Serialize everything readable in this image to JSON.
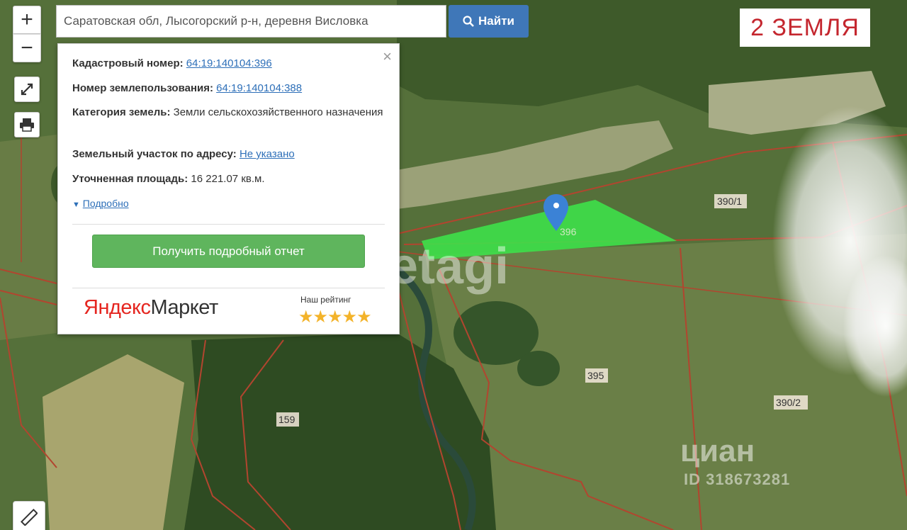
{
  "search": {
    "value": "Саратовская обл, Лысогорский р-н, деревня Висловка",
    "button_label": "Найти"
  },
  "controls": {
    "zoom_in": "+",
    "zoom_out": "−"
  },
  "overlay_label": "2 ЗЕМЛЯ",
  "popup": {
    "cadastral_label": "Кадастровый номер:",
    "cadastral_value": "64:19:140104:396",
    "land_use_label": "Номер землепользования:",
    "land_use_value": "64:19:140104:388",
    "category_label": "Категория земель:",
    "category_value": "Земли сельскохозяйственного назначения",
    "address_label": "Земельный участок по адресу:",
    "address_value": "Не указано",
    "area_label": "Уточненная площадь:",
    "area_value": "16 221.07 кв.м.",
    "more_link": "Подробно",
    "report_button": "Получить подробный отчет",
    "logo_part1": "Яндекс",
    "logo_part2": "Маркет",
    "rating_label": "Наш рейтинг",
    "stars": "★★★★★"
  },
  "parcel_labels": {
    "p396": "396",
    "p390_1": "390/1",
    "p395": "395",
    "p390_2": "390/2",
    "p159": "159"
  },
  "watermarks": {
    "etagi": "etagi",
    "cian": "циан",
    "cian_id": "ID 318673281"
  },
  "colors": {
    "parcel_fill": "#3ee04a",
    "boundary": "#b2452f",
    "search_button": "#3f77b8",
    "report_button": "#5fb55d",
    "label_text": "#c4262e",
    "marker": "#3b82d6"
  }
}
